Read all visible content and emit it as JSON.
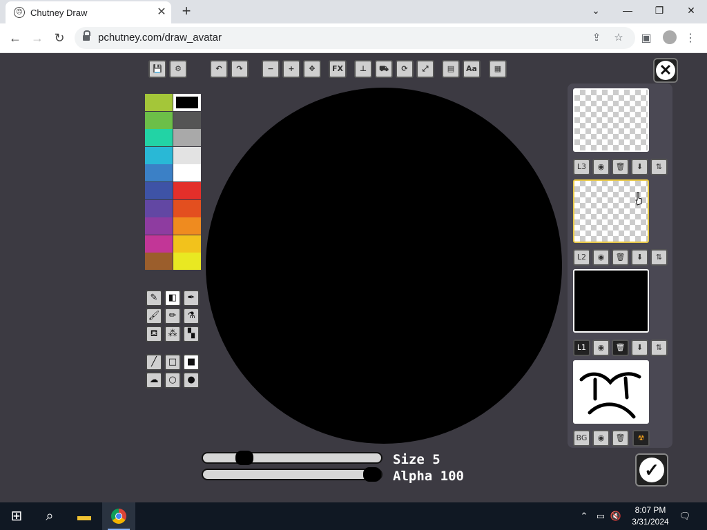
{
  "browser": {
    "tab_title": "Chutney Draw",
    "url": "pchutney.com/draw_avatar",
    "tab_close": "✕",
    "new_tab": "+",
    "window": {
      "minimize": "—",
      "maximize": "❐",
      "close": "✕",
      "menu": "⌄"
    }
  },
  "toolbar": {
    "fx_label": "FX",
    "text_label": "Aa"
  },
  "palette": {
    "colors": [
      "#a4c639",
      "#000000",
      "#6cbf48",
      "#555555",
      "#22d3a5",
      "#a9a9a9",
      "#29b8d6",
      "#e3e3e3",
      "#3b80c6",
      "#ffffff",
      "#3e53a6",
      "#e32f2a",
      "#6247a3",
      "#e34f1f",
      "#8e3ca0",
      "#ef8b1f",
      "#c23697",
      "#f2c21c",
      "#9b5e2c",
      "#e9e822"
    ],
    "selected_index": 1
  },
  "brush": {
    "size_label": "Size 5",
    "size_value": 5,
    "alpha_label": "Alpha 100",
    "alpha_value": 100
  },
  "layers": {
    "items": [
      {
        "label": "L3"
      },
      {
        "label": "L2"
      },
      {
        "label": "L1"
      },
      {
        "label": "BG"
      }
    ]
  },
  "taskbar": {
    "time": "8:07 PM",
    "date": "3/31/2024"
  }
}
